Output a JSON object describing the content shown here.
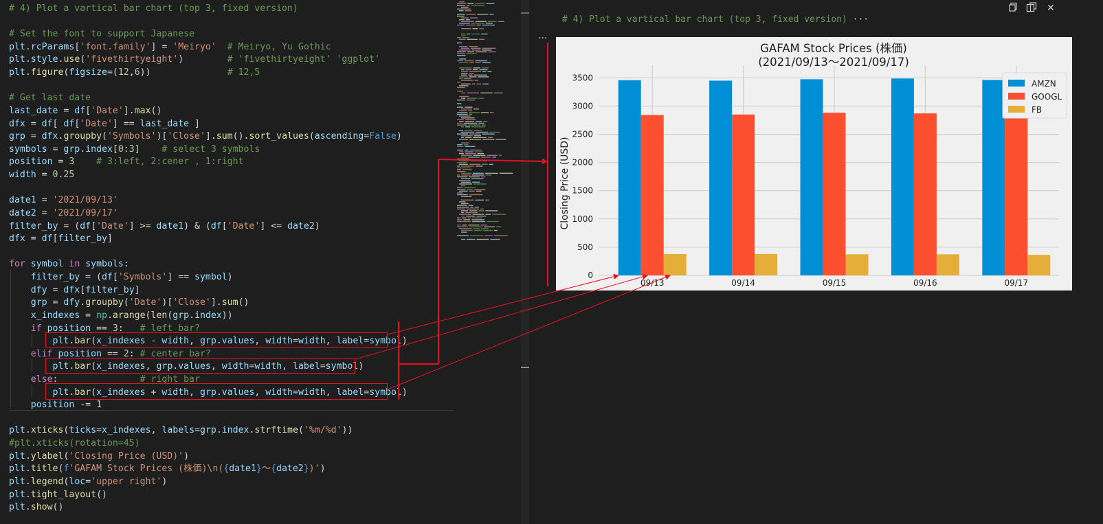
{
  "code": {
    "lines": [
      [
        [
          "# 4) Plot a vartical bar chart (top 3, fixed version)",
          "c"
        ]
      ],
      [],
      [
        [
          "# Set the font to support Japanese",
          "c"
        ]
      ],
      [
        [
          "plt",
          "v"
        ],
        [
          ".",
          ""
        ],
        [
          "rcParams",
          "v"
        ],
        [
          "[",
          ""
        ],
        [
          "'font.family'",
          "s"
        ],
        [
          "] = ",
          ""
        ],
        [
          "'Meiryo'",
          "s"
        ],
        [
          "  ",
          ""
        ],
        [
          "# Meiryo, Yu Gothic",
          "c"
        ]
      ],
      [
        [
          "plt",
          "v"
        ],
        [
          ".",
          ""
        ],
        [
          "style",
          "v"
        ],
        [
          ".",
          ""
        ],
        [
          "use",
          "f"
        ],
        [
          "(",
          ""
        ],
        [
          "'fivethirtyeight'",
          "s"
        ],
        [
          ")        ",
          ""
        ],
        [
          "# 'fivethirtyeight' 'ggplot'",
          "c"
        ]
      ],
      [
        [
          "plt",
          "v"
        ],
        [
          ".",
          ""
        ],
        [
          "figure",
          "f"
        ],
        [
          "(",
          ""
        ],
        [
          "figsize",
          "v"
        ],
        [
          "=(",
          ""
        ],
        [
          "12",
          "n"
        ],
        [
          ",",
          ""
        ],
        [
          "6",
          "n"
        ],
        [
          "))              ",
          ""
        ],
        [
          "# 12,5",
          "c"
        ]
      ],
      [],
      [
        [
          "# Get last date",
          "c"
        ]
      ],
      [
        [
          "last_date",
          "v"
        ],
        [
          " = ",
          ""
        ],
        [
          "df",
          "v"
        ],
        [
          "[",
          ""
        ],
        [
          "'Date'",
          "s"
        ],
        [
          "].",
          ""
        ],
        [
          "max",
          "f"
        ],
        [
          "()",
          ""
        ]
      ],
      [
        [
          "dfx",
          "v"
        ],
        [
          " = ",
          ""
        ],
        [
          "df",
          "v"
        ],
        [
          "[ ",
          ""
        ],
        [
          "df",
          "v"
        ],
        [
          "[",
          ""
        ],
        [
          "'Date'",
          "s"
        ],
        [
          "] == ",
          ""
        ],
        [
          "last_date",
          "v"
        ],
        [
          " ]",
          ""
        ]
      ],
      [
        [
          "grp",
          "v"
        ],
        [
          " = ",
          ""
        ],
        [
          "dfx",
          "v"
        ],
        [
          ".",
          ""
        ],
        [
          "groupby",
          "f"
        ],
        [
          "(",
          ""
        ],
        [
          "'Symbols'",
          "s"
        ],
        [
          ")[",
          ""
        ],
        [
          "'Close'",
          "s"
        ],
        [
          "].",
          ""
        ],
        [
          "sum",
          "f"
        ],
        [
          "().",
          ""
        ],
        [
          "sort_values",
          "f"
        ],
        [
          "(",
          ""
        ],
        [
          "ascending",
          "v"
        ],
        [
          "=",
          ""
        ],
        [
          "False",
          "b"
        ],
        [
          ")",
          ""
        ]
      ],
      [
        [
          "symbols",
          "v"
        ],
        [
          " = ",
          ""
        ],
        [
          "grp",
          "v"
        ],
        [
          ".",
          ""
        ],
        [
          "index",
          "v"
        ],
        [
          "[",
          ""
        ],
        [
          "0",
          "n"
        ],
        [
          ":",
          ""
        ],
        [
          "3",
          "n"
        ],
        [
          "]    ",
          ""
        ],
        [
          "# select 3 symbols",
          "c"
        ]
      ],
      [
        [
          "position",
          "v"
        ],
        [
          " = ",
          ""
        ],
        [
          "3",
          "n"
        ],
        [
          "    ",
          ""
        ],
        [
          "# 3:left, 2:cener , 1:right",
          "c"
        ]
      ],
      [
        [
          "width",
          "v"
        ],
        [
          " = ",
          ""
        ],
        [
          "0.25",
          "n"
        ]
      ],
      [],
      [
        [
          "date1",
          "v"
        ],
        [
          " = ",
          ""
        ],
        [
          "'2021/09/13'",
          "s"
        ]
      ],
      [
        [
          "date2",
          "v"
        ],
        [
          " = ",
          ""
        ],
        [
          "'2021/09/17'",
          "s"
        ]
      ],
      [
        [
          "filter_by",
          "v"
        ],
        [
          " = (",
          ""
        ],
        [
          "df",
          "v"
        ],
        [
          "[",
          ""
        ],
        [
          "'Date'",
          "s"
        ],
        [
          "] >= ",
          ""
        ],
        [
          "date1",
          "v"
        ],
        [
          ") & (",
          ""
        ],
        [
          "df",
          "v"
        ],
        [
          "[",
          ""
        ],
        [
          "'Date'",
          "s"
        ],
        [
          "] <= ",
          ""
        ],
        [
          "date2",
          "v"
        ],
        [
          ")",
          ""
        ]
      ],
      [
        [
          "dfx",
          "v"
        ],
        [
          " = ",
          ""
        ],
        [
          "df",
          "v"
        ],
        [
          "[",
          ""
        ],
        [
          "filter_by",
          "v"
        ],
        [
          "]",
          ""
        ]
      ],
      [],
      [
        [
          "for",
          "k"
        ],
        [
          " ",
          ""
        ],
        [
          "symbol",
          "v"
        ],
        [
          " ",
          ""
        ],
        [
          "in",
          "k"
        ],
        [
          " ",
          ""
        ],
        [
          "symbols",
          "v"
        ],
        [
          ":",
          ""
        ]
      ],
      [
        [
          "    ",
          ""
        ],
        [
          "filter_by",
          "v"
        ],
        [
          " = (",
          ""
        ],
        [
          "df",
          "v"
        ],
        [
          "[",
          ""
        ],
        [
          "'Symbols'",
          "s"
        ],
        [
          "] == ",
          ""
        ],
        [
          "symbol",
          "v"
        ],
        [
          ")",
          ""
        ]
      ],
      [
        [
          "    ",
          ""
        ],
        [
          "dfy",
          "v"
        ],
        [
          " = ",
          ""
        ],
        [
          "dfx",
          "v"
        ],
        [
          "[",
          ""
        ],
        [
          "filter_by",
          "v"
        ],
        [
          "]",
          ""
        ]
      ],
      [
        [
          "    ",
          ""
        ],
        [
          "grp",
          "v"
        ],
        [
          " = ",
          ""
        ],
        [
          "dfy",
          "v"
        ],
        [
          ".",
          ""
        ],
        [
          "groupby",
          "f"
        ],
        [
          "(",
          ""
        ],
        [
          "'Date'",
          "s"
        ],
        [
          ")[",
          ""
        ],
        [
          "'Close'",
          "s"
        ],
        [
          "].",
          ""
        ],
        [
          "sum",
          "f"
        ],
        [
          "()",
          ""
        ]
      ],
      [
        [
          "    ",
          ""
        ],
        [
          "x_indexes",
          "v"
        ],
        [
          " = ",
          ""
        ],
        [
          "np",
          "t"
        ],
        [
          ".",
          ""
        ],
        [
          "arange",
          "f"
        ],
        [
          "(",
          ""
        ],
        [
          "len",
          "f"
        ],
        [
          "(",
          ""
        ],
        [
          "grp",
          "v"
        ],
        [
          ".",
          ""
        ],
        [
          "index",
          "v"
        ],
        [
          "))",
          ""
        ]
      ],
      [
        [
          "    ",
          ""
        ],
        [
          "if",
          "k"
        ],
        [
          " ",
          ""
        ],
        [
          "position",
          "v"
        ],
        [
          " == ",
          ""
        ],
        [
          "3",
          "n"
        ],
        [
          ":   ",
          ""
        ],
        [
          "# left bar?",
          "c"
        ]
      ],
      [
        [
          "        ",
          ""
        ],
        [
          "plt",
          "v"
        ],
        [
          ".",
          ""
        ],
        [
          "bar",
          "f"
        ],
        [
          "(",
          ""
        ],
        [
          "x_indexes",
          "v"
        ],
        [
          " - ",
          ""
        ],
        [
          "width",
          "v"
        ],
        [
          ", ",
          ""
        ],
        [
          "grp",
          "v"
        ],
        [
          ".",
          ""
        ],
        [
          "values",
          "v"
        ],
        [
          ", ",
          ""
        ],
        [
          "width",
          "v"
        ],
        [
          "=",
          ""
        ],
        [
          "width",
          "v"
        ],
        [
          ", ",
          ""
        ],
        [
          "label",
          "v"
        ],
        [
          "=",
          ""
        ],
        [
          "symbol",
          "v"
        ],
        [
          ")",
          ""
        ]
      ],
      [
        [
          "    ",
          ""
        ],
        [
          "elif",
          "k"
        ],
        [
          " ",
          ""
        ],
        [
          "position",
          "v"
        ],
        [
          " == ",
          ""
        ],
        [
          "2",
          "n"
        ],
        [
          ": ",
          ""
        ],
        [
          "# center bar?",
          "c"
        ]
      ],
      [
        [
          "        ",
          ""
        ],
        [
          "plt",
          "v"
        ],
        [
          ".",
          ""
        ],
        [
          "bar",
          "f"
        ],
        [
          "(",
          ""
        ],
        [
          "x_indexes",
          "v"
        ],
        [
          ", ",
          ""
        ],
        [
          "grp",
          "v"
        ],
        [
          ".",
          ""
        ],
        [
          "values",
          "v"
        ],
        [
          ", ",
          ""
        ],
        [
          "width",
          "v"
        ],
        [
          "=",
          ""
        ],
        [
          "width",
          "v"
        ],
        [
          ", ",
          ""
        ],
        [
          "label",
          "v"
        ],
        [
          "=",
          ""
        ],
        [
          "symbol",
          "v"
        ],
        [
          ")",
          ""
        ]
      ],
      [
        [
          "    ",
          ""
        ],
        [
          "else",
          "k"
        ],
        [
          ":               ",
          ""
        ],
        [
          "# right bar",
          "c"
        ]
      ],
      [
        [
          "        ",
          ""
        ],
        [
          "plt",
          "v"
        ],
        [
          ".",
          ""
        ],
        [
          "bar",
          "f"
        ],
        [
          "(",
          ""
        ],
        [
          "x_indexes",
          "v"
        ],
        [
          " + ",
          ""
        ],
        [
          "width",
          "v"
        ],
        [
          ", ",
          ""
        ],
        [
          "grp",
          "v"
        ],
        [
          ".",
          ""
        ],
        [
          "values",
          "v"
        ],
        [
          ", ",
          ""
        ],
        [
          "width",
          "v"
        ],
        [
          "=",
          ""
        ],
        [
          "width",
          "v"
        ],
        [
          ", ",
          ""
        ],
        [
          "label",
          "v"
        ],
        [
          "=",
          ""
        ],
        [
          "symbol",
          "v"
        ],
        [
          ")",
          ""
        ]
      ],
      [
        [
          "    ",
          ""
        ],
        [
          "position",
          "v"
        ],
        [
          " -= ",
          ""
        ],
        [
          "1",
          "n"
        ]
      ],
      [],
      [
        [
          "plt",
          "v"
        ],
        [
          ".",
          ""
        ],
        [
          "xticks",
          "f"
        ],
        [
          "(",
          ""
        ],
        [
          "ticks",
          "v"
        ],
        [
          "=",
          ""
        ],
        [
          "x_indexes",
          "v"
        ],
        [
          ", ",
          ""
        ],
        [
          "labels",
          "v"
        ],
        [
          "=",
          ""
        ],
        [
          "grp",
          "v"
        ],
        [
          ".",
          ""
        ],
        [
          "index",
          "v"
        ],
        [
          ".",
          ""
        ],
        [
          "strftime",
          "f"
        ],
        [
          "(",
          ""
        ],
        [
          "'%m/%d'",
          "s"
        ],
        [
          "))",
          ""
        ]
      ],
      [
        [
          "#plt.xticks(rotation=45)",
          "c"
        ]
      ],
      [
        [
          "plt",
          "v"
        ],
        [
          ".",
          ""
        ],
        [
          "ylabel",
          "f"
        ],
        [
          "(",
          ""
        ],
        [
          "'Closing Price (USD)'",
          "s"
        ],
        [
          ")",
          ""
        ]
      ],
      [
        [
          "plt",
          "v"
        ],
        [
          ".",
          ""
        ],
        [
          "title",
          "f"
        ],
        [
          "(",
          ""
        ],
        [
          "f",
          "b"
        ],
        [
          "'GAFAM Stock Prices (株価)\\n(",
          "s"
        ],
        [
          "{",
          "b"
        ],
        [
          "date1",
          "v"
        ],
        [
          "}",
          "b"
        ],
        [
          "～",
          "s"
        ],
        [
          "{",
          "b"
        ],
        [
          "date2",
          "v"
        ],
        [
          "}",
          "b"
        ],
        [
          ")'",
          "s"
        ],
        [
          ")",
          ""
        ]
      ],
      [
        [
          "plt",
          "v"
        ],
        [
          ".",
          ""
        ],
        [
          "legend",
          "f"
        ],
        [
          "(",
          ""
        ],
        [
          "loc",
          "v"
        ],
        [
          "=",
          ""
        ],
        [
          "'upper right'",
          "s"
        ],
        [
          ")",
          ""
        ]
      ],
      [
        [
          "plt",
          "v"
        ],
        [
          ".",
          ""
        ],
        [
          "tight_layout",
          "f"
        ],
        [
          "()",
          ""
        ]
      ],
      [
        [
          "plt",
          "v"
        ],
        [
          ".",
          ""
        ],
        [
          "show",
          "f"
        ],
        [
          "()",
          ""
        ]
      ]
    ]
  },
  "output": {
    "header": "# 4) Plot a vartical bar chart (top 3, fixed version)",
    "header_ellipsis": "···",
    "more_label": "···"
  },
  "toolbar": {
    "icons": [
      "copy-icon",
      "split-editor-icon",
      "close-icon"
    ],
    "close_glyph": "✕"
  },
  "chart_data": {
    "type": "bar",
    "title": "GAFAM Stock Prices (株価)",
    "subtitle": "(2021/09/13～2021/09/17)",
    "xlabel": "",
    "ylabel": "Closing Price (USD)",
    "categories": [
      "09/13",
      "09/14",
      "09/15",
      "09/16",
      "09/17"
    ],
    "ylim": [
      0,
      3650
    ],
    "yticks": [
      0,
      500,
      1000,
      1500,
      2000,
      2500,
      3000,
      3500
    ],
    "grid": true,
    "legend_position": "upper right",
    "series": [
      {
        "name": "AMZN",
        "color": "#008fd5",
        "values": [
          3458,
          3450,
          3475,
          3488,
          3462
        ]
      },
      {
        "name": "GOOGL",
        "color": "#fc4f30",
        "values": [
          2842,
          2850,
          2882,
          2870,
          2829
        ]
      },
      {
        "name": "FB",
        "color": "#e5ae38",
        "values": [
          377,
          379,
          374,
          373,
          364
        ]
      }
    ]
  }
}
